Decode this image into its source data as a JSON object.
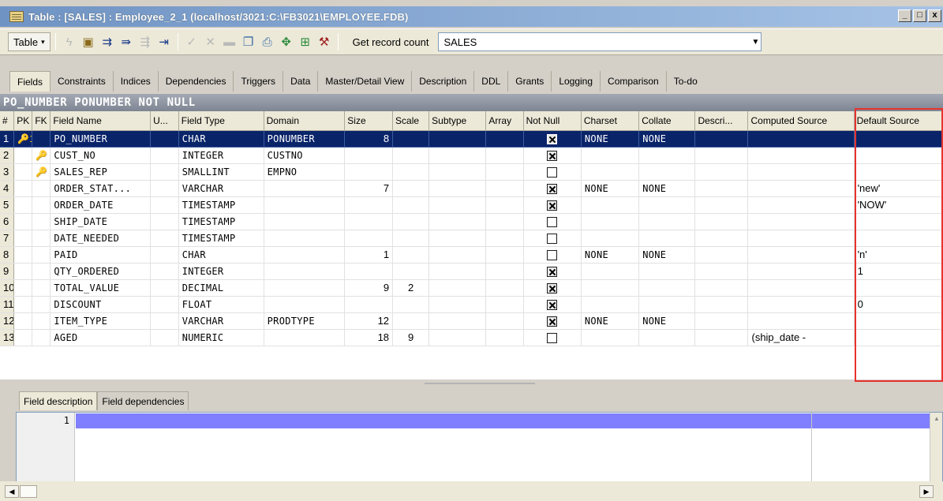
{
  "window": {
    "title": "Table : [SALES] : Employee_2_1 (localhost/3021:C:\\FB3021\\EMPLOYEE.FDB)",
    "minimize": "_",
    "restore": "□",
    "close": "x"
  },
  "toolbar": {
    "table_label": "Table",
    "get_record_count": "Get record count",
    "table_name": "SALES"
  },
  "tabs": [
    "Fields",
    "Constraints",
    "Indices",
    "Dependencies",
    "Triggers",
    "Data",
    "Master/Detail View",
    "Description",
    "DDL",
    "Grants",
    "Logging",
    "Comparison",
    "To-do"
  ],
  "header_strip": "PO_NUMBER PONUMBER NOT NULL",
  "columns": [
    "#",
    "PK",
    "FK",
    "Field Name",
    "U...",
    "Field Type",
    "Domain",
    "Size",
    "Scale",
    "Subtype",
    "Array",
    "Not Null",
    "Charset",
    "Collate",
    "Descri...",
    "Computed Source",
    "Default Source"
  ],
  "rows": [
    {
      "n": "1",
      "pk": "🔑1",
      "fk": "",
      "name": "PO_NUMBER",
      "type": "CHAR",
      "domain": "PONUMBER",
      "size": "8",
      "scale": "",
      "notnull": true,
      "charset": "NONE",
      "collate": "NONE",
      "computed": "",
      "default": ""
    },
    {
      "n": "2",
      "pk": "",
      "fk": "🔑",
      "name": "CUST_NO",
      "type": "INTEGER",
      "domain": "CUSTNO",
      "size": "",
      "scale": "",
      "notnull": true,
      "charset": "",
      "collate": "",
      "computed": "",
      "default": ""
    },
    {
      "n": "3",
      "pk": "",
      "fk": "🔑",
      "name": "SALES_REP",
      "type": "SMALLINT",
      "domain": "EMPNO",
      "size": "",
      "scale": "",
      "notnull": false,
      "charset": "",
      "collate": "",
      "computed": "",
      "default": ""
    },
    {
      "n": "4",
      "pk": "",
      "fk": "",
      "name": "ORDER_STAT...",
      "type": "VARCHAR",
      "domain": "",
      "size": "7",
      "scale": "",
      "notnull": true,
      "charset": "NONE",
      "collate": "NONE",
      "computed": "",
      "default": "'new'"
    },
    {
      "n": "5",
      "pk": "",
      "fk": "",
      "name": "ORDER_DATE",
      "type": "TIMESTAMP",
      "domain": "",
      "size": "",
      "scale": "",
      "notnull": true,
      "charset": "",
      "collate": "",
      "computed": "",
      "default": "'NOW'"
    },
    {
      "n": "6",
      "pk": "",
      "fk": "",
      "name": "SHIP_DATE",
      "type": "TIMESTAMP",
      "domain": "",
      "size": "",
      "scale": "",
      "notnull": false,
      "charset": "",
      "collate": "",
      "computed": "",
      "default": ""
    },
    {
      "n": "7",
      "pk": "",
      "fk": "",
      "name": "DATE_NEEDED",
      "type": "TIMESTAMP",
      "domain": "",
      "size": "",
      "scale": "",
      "notnull": false,
      "charset": "",
      "collate": "",
      "computed": "",
      "default": ""
    },
    {
      "n": "8",
      "pk": "",
      "fk": "",
      "name": "PAID",
      "type": "CHAR",
      "domain": "",
      "size": "1",
      "scale": "",
      "notnull": false,
      "charset": "NONE",
      "collate": "NONE",
      "computed": "",
      "default": "'n'"
    },
    {
      "n": "9",
      "pk": "",
      "fk": "",
      "name": "QTY_ORDERED",
      "type": "INTEGER",
      "domain": "",
      "size": "",
      "scale": "",
      "notnull": true,
      "charset": "",
      "collate": "",
      "computed": "",
      "default": "1"
    },
    {
      "n": "10",
      "pk": "",
      "fk": "",
      "name": "TOTAL_VALUE",
      "type": "DECIMAL",
      "domain": "",
      "size": "9",
      "scale": "2",
      "notnull": true,
      "charset": "",
      "collate": "",
      "computed": "",
      "default": ""
    },
    {
      "n": "11",
      "pk": "",
      "fk": "",
      "name": "DISCOUNT",
      "type": "FLOAT",
      "domain": "",
      "size": "",
      "scale": "",
      "notnull": true,
      "charset": "",
      "collate": "",
      "computed": "",
      "default": "0"
    },
    {
      "n": "12",
      "pk": "",
      "fk": "",
      "name": "ITEM_TYPE",
      "type": "VARCHAR",
      "domain": "PRODTYPE",
      "size": "12",
      "scale": "",
      "notnull": true,
      "charset": "NONE",
      "collate": "NONE",
      "computed": "",
      "default": ""
    },
    {
      "n": "13",
      "pk": "",
      "fk": "",
      "name": "AGED",
      "type": "NUMERIC",
      "domain": "",
      "size": "18",
      "scale": "9",
      "notnull": false,
      "charset": "",
      "collate": "",
      "computed": "(ship_date -",
      "default": ""
    }
  ],
  "bottom_tabs": [
    "Field description",
    "Field dependencies"
  ],
  "editor": {
    "line_number": "1"
  },
  "colors": {
    "selection": "#0a246a",
    "highlight_box": "#e8322e",
    "editor_line": "#7f7fff"
  }
}
